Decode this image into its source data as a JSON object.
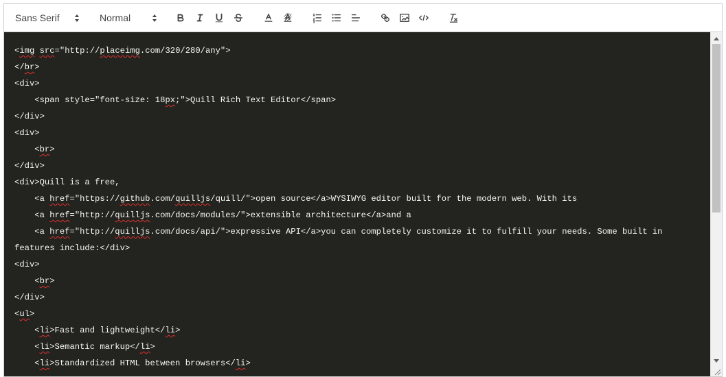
{
  "toolbar": {
    "font_picker": {
      "selected": "Sans Serif"
    },
    "size_picker": {
      "selected": "Normal"
    },
    "buttons": [
      {
        "name": "bold",
        "icon": "bold-icon"
      },
      {
        "name": "italic",
        "icon": "italic-icon"
      },
      {
        "name": "underline",
        "icon": "underline-icon"
      },
      {
        "name": "strike",
        "icon": "strikethrough-icon"
      },
      {
        "name": "color",
        "icon": "text-color-icon"
      },
      {
        "name": "background",
        "icon": "highlight-icon"
      },
      {
        "name": "ordered-list",
        "icon": "ordered-list-icon"
      },
      {
        "name": "bullet-list",
        "icon": "bullet-list-icon"
      },
      {
        "name": "align",
        "icon": "align-left-icon"
      },
      {
        "name": "link",
        "icon": "link-icon"
      },
      {
        "name": "image",
        "icon": "image-icon"
      },
      {
        "name": "code-view",
        "icon": "code-icon"
      },
      {
        "name": "clean",
        "icon": "clear-format-icon"
      }
    ]
  },
  "colors": {
    "code_background": "#23241f",
    "code_text": "#f8f8f2",
    "icon_stroke": "#444444",
    "spellcheck_underline": "#e03030"
  },
  "code_lines": [
    "<img src=\"http://placeimg.com/320/280/any\">",
    "</br>",
    "<div>",
    "    <span style=\"font-size: 18px;\">Quill Rich Text Editor</span>",
    "</div>",
    "<div>",
    "    <br>",
    "</div>",
    "<div>Quill is a free,",
    "    <a href=\"https://github.com/quilljs/quill/\">open source</a>WYSIWYG editor built for the modern web. With its",
    "    <a href=\"http://quilljs.com/docs/modules/\">extensible architecture</a>and a",
    "    <a href=\"http://quilljs.com/docs/api/\">expressive API</a>you can completely customize it to fulfill your needs. Some built in",
    "features include:</div>",
    "<div>",
    "    <br>",
    "</div>",
    "<ul>",
    "    <li>Fast and lightweight</li>",
    "    <li>Semantic markup</li>",
    "    <li>Standardized HTML between browsers</li>"
  ],
  "spellcheck_words": [
    "img",
    "src",
    "placeimg",
    "br",
    "px",
    "href",
    "github",
    "quilljs",
    "ul",
    "li"
  ]
}
